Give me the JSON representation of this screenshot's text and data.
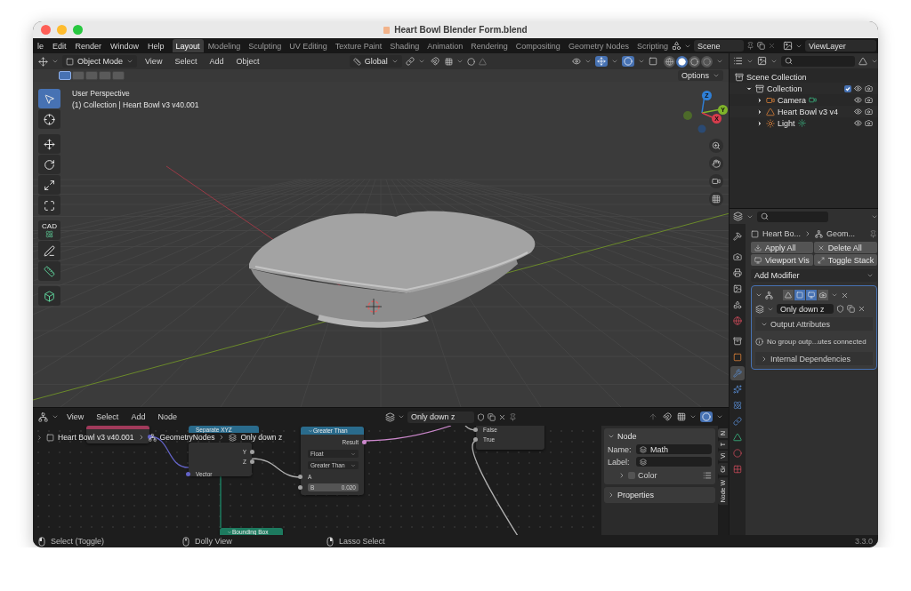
{
  "window": {
    "title": "Heart Bowl Blender Form.blend"
  },
  "menu": [
    "le",
    "Edit",
    "Render",
    "Window",
    "Help"
  ],
  "workspaces": [
    {
      "label": "Layout",
      "selected": true
    },
    {
      "label": "Modeling",
      "selected": false
    },
    {
      "label": "Sculpting",
      "selected": false
    },
    {
      "label": "UV Editing",
      "selected": false
    },
    {
      "label": "Texture Paint",
      "selected": false
    },
    {
      "label": "Shading",
      "selected": false
    },
    {
      "label": "Animation",
      "selected": false
    },
    {
      "label": "Rendering",
      "selected": false
    },
    {
      "label": "Compositing",
      "selected": false
    },
    {
      "label": "Geometry Nodes",
      "selected": false
    },
    {
      "label": "Scripting",
      "selected": false
    }
  ],
  "scene": "Scene",
  "view_layer": "ViewLayer",
  "viewport": {
    "mode": "Object Mode",
    "menus": [
      "View",
      "Select",
      "Add",
      "Object"
    ],
    "orientation": "Global",
    "options": "Options",
    "info": [
      "User Perspective",
      "(1) Collection | Heart Bowl v3 v40.001"
    ],
    "select_modes": [
      {
        "selected": true
      },
      {
        "selected": false
      },
      {
        "selected": false
      },
      {
        "selected": false
      },
      {
        "selected": false
      }
    ],
    "shading": [
      {
        "kind": "wire",
        "selected": false
      },
      {
        "kind": "solid",
        "selected": true
      },
      {
        "kind": "material",
        "selected": false
      },
      {
        "kind": "render",
        "selected": false
      }
    ],
    "tools": [
      {
        "kind": "select",
        "selected": true
      },
      {
        "kind": "cursor",
        "selected": false
      },
      {
        "kind": "move",
        "selected": false
      },
      {
        "kind": "rotate",
        "selected": false
      },
      {
        "kind": "scale",
        "selected": false
      },
      {
        "kind": "transform",
        "selected": false
      },
      {
        "kind": "cad",
        "label": "CAD",
        "selected": false
      },
      {
        "kind": "annotate",
        "selected": false
      },
      {
        "kind": "measure",
        "selected": false
      },
      {
        "kind": "add-cube",
        "selected": false
      }
    ],
    "gizmo": [
      {
        "label": "Z",
        "color": "#2f7fd6"
      },
      {
        "label": "Y",
        "color": "#7fb32a"
      },
      {
        "label": "X",
        "color": "#d63c4c"
      }
    ]
  },
  "outliner": {
    "items": [
      {
        "label": "Scene Collection",
        "kind": "scene",
        "children": [
          {
            "label": "Collection",
            "kind": "collection",
            "expanded": true,
            "checked": true,
            "children": [
              {
                "label": "Camera",
                "kind": "camera",
                "expanded": false
              },
              {
                "label": "Heart Bowl v3 v4",
                "kind": "mesh",
                "expanded": false
              },
              {
                "label": "Light",
                "kind": "light",
                "expanded": false
              }
            ]
          }
        ]
      }
    ]
  },
  "properties": {
    "tabs": [
      {
        "kind": "tool",
        "selected": false
      },
      {
        "kind": "render",
        "selected": false
      },
      {
        "kind": "output",
        "selected": false
      },
      {
        "kind": "view_layer",
        "selected": false
      },
      {
        "kind": "scene",
        "selected": false
      },
      {
        "kind": "world",
        "selected": false
      },
      {
        "kind": "collection",
        "selected": false
      },
      {
        "kind": "object",
        "selected": false
      },
      {
        "kind": "modifier",
        "selected": true
      },
      {
        "kind": "particles",
        "selected": false
      },
      {
        "kind": "physics",
        "selected": false
      },
      {
        "kind": "constraints",
        "selected": false
      },
      {
        "kind": "data",
        "selected": false
      },
      {
        "kind": "material",
        "selected": false
      },
      {
        "kind": "texture",
        "selected": false
      }
    ],
    "breadcrumb": [
      "Heart Bo...",
      "Geom..."
    ],
    "buttons": [
      "Apply All",
      "Delete All",
      "Viewport Vis",
      "Toggle Stack"
    ],
    "add_modifier": "Add Modifier",
    "modifier": {
      "expanded": true,
      "name": "Only down z",
      "toggles": [
        {
          "kind": "cage",
          "on": false
        },
        {
          "kind": "edit",
          "on": true
        },
        {
          "kind": "viewport",
          "on": true
        },
        {
          "kind": "render",
          "on": false
        }
      ],
      "sections": [
        {
          "label": "Output Attributes",
          "expanded": true,
          "info": "No group outp...utes connected"
        },
        {
          "label": "Internal Dependencies",
          "expanded": false
        }
      ]
    }
  },
  "node_editor": {
    "menus": [
      "View",
      "Select",
      "Add",
      "Node"
    ],
    "node_group": "Only down z",
    "breadcrumb": [
      "Heart Bowl v3 v40.001",
      "GeometryNodes",
      "Only down z"
    ],
    "nodes": [
      {
        "kind": "input"
      },
      {
        "kind": "vector",
        "title": "Separate XYZ",
        "outputs": [
          "Y",
          "Z"
        ],
        "inputs": [
          "Vector"
        ]
      },
      {
        "kind": "converter",
        "title": "Greater Than",
        "outputs": [
          "Result"
        ],
        "menus": [
          "Float",
          "Greater Than"
        ],
        "inputs": [
          "A"
        ],
        "field": {
          "label": "B",
          "value": "0.020"
        }
      },
      {
        "kind": "utility",
        "inputs": [
          "False",
          "True"
        ]
      },
      {
        "kind": "geometry",
        "title": "Bounding Box"
      }
    ],
    "sidebar": {
      "panel": "Node",
      "expanded": true,
      "fields": [
        {
          "label": "Name:",
          "value": "Math"
        },
        {
          "label": "Label:"
        }
      ],
      "color": {
        "label": "Color",
        "checked": false,
        "expanded": false
      },
      "properties": {
        "label": "Properties",
        "expanded": false
      }
    },
    "tabs": [
      {
        "label": "N",
        "selected": true
      },
      {
        "label": "T",
        "selected": false
      },
      {
        "label": "Vi",
        "selected": false
      },
      {
        "label": "Gr",
        "selected": false
      },
      {
        "label": "Node W",
        "selected": false
      }
    ]
  },
  "status_bar": {
    "items": [
      {
        "kind": "mouse-left",
        "label": "Select (Toggle)"
      },
      {
        "kind": "mouse-middle",
        "label": "Dolly View"
      },
      {
        "kind": "mouse-right",
        "label": "Lasso Select"
      }
    ],
    "version": "3.3.0"
  }
}
